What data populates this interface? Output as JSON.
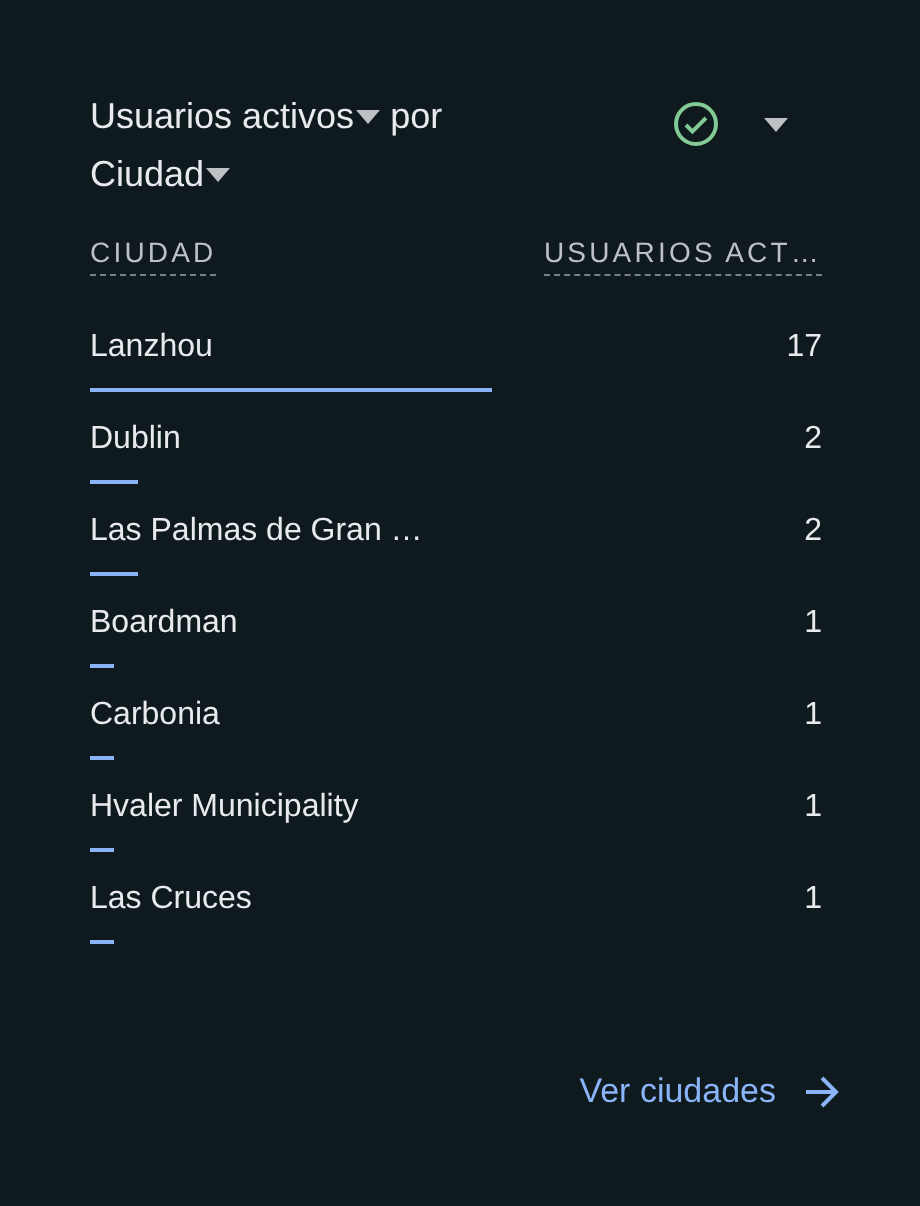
{
  "title": {
    "metric": "Usuarios activos",
    "joiner": "por",
    "dimension": "Ciudad"
  },
  "table": {
    "columns": [
      "CIUDAD",
      "USUARIOS ACT…"
    ],
    "rows": [
      {
        "city": "Lanzhou",
        "value": "17"
      },
      {
        "city": "Dublin",
        "value": "2"
      },
      {
        "city": "Las Palmas de Gran …",
        "value": "2"
      },
      {
        "city": "Boardman",
        "value": "1"
      },
      {
        "city": "Carbonia",
        "value": "1"
      },
      {
        "city": "Hvaler Municipality",
        "value": "1"
      },
      {
        "city": "Las Cruces",
        "value": "1"
      }
    ]
  },
  "link": {
    "label": "Ver ciudades"
  }
}
